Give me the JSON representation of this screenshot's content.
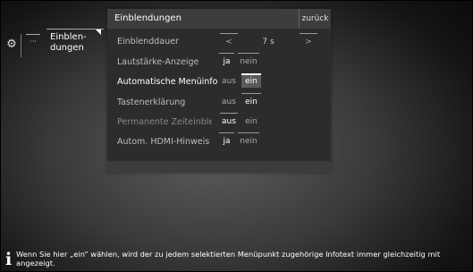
{
  "breadcrumb": {
    "gear_icon": "gear-icon",
    "dots": "···",
    "label": "Einblen-\ndungen"
  },
  "panel": {
    "title": "Einblendungen",
    "back": "zurück",
    "rows": [
      {
        "label": "Einblenddauer",
        "left": "<",
        "value": "7 s",
        "right": ">"
      },
      {
        "label": "Lautstärke-Anzeige",
        "opt1": "ja",
        "opt2": "nein"
      },
      {
        "label": "Automatische Menüinfo",
        "opt1": "aus",
        "opt2": "ein"
      },
      {
        "label": "Tastenerklärung",
        "opt1": "aus",
        "opt2": "ein"
      },
      {
        "label": "Permanente Zeiteinblendung",
        "opt1": "aus",
        "opt2": "ein"
      },
      {
        "label": "Autom. HDMI-Hinweis",
        "opt1": "ja",
        "opt2": "nein"
      }
    ]
  },
  "info": {
    "icon": "info-icon",
    "text": "Wenn Sie hier „ein“ wählen, wird der zu jedem selektierten Menüpunkt zugehörige Infotext immer gleichzeitig mit angezeigt."
  }
}
